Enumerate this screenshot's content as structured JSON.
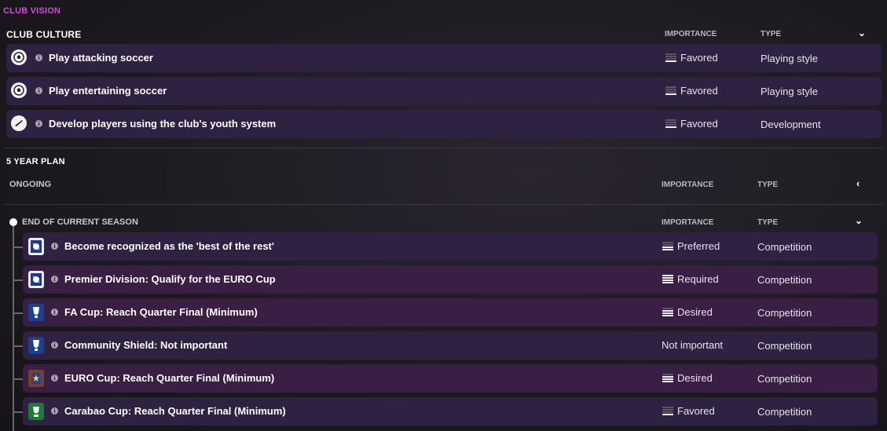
{
  "header": {
    "title": "CLUB VISION"
  },
  "club_culture": {
    "title": "CLUB CULTURE",
    "col_importance": "IMPORTANCE",
    "col_type": "TYPE",
    "items": [
      {
        "label": "Play attacking soccer",
        "importance": "Favored",
        "type": "Playing style",
        "icon": "soccer-ball-icon"
      },
      {
        "label": "Play entertaining soccer",
        "importance": "Favored",
        "type": "Playing style",
        "icon": "soccer-ball-icon"
      },
      {
        "label": "Develop players using the club's youth system",
        "importance": "Favored",
        "type": "Development",
        "icon": "boot-icon"
      }
    ]
  },
  "five_year_plan": {
    "title": "5 YEAR PLAN",
    "ongoing": {
      "title": "ONGOING",
      "col_importance": "IMPORTANCE",
      "col_type": "TYPE"
    },
    "current_season": {
      "title": "END OF CURRENT SEASON",
      "col_importance": "IMPORTANCE",
      "col_type": "TYPE",
      "items": [
        {
          "label": "Become recognized as the 'best of the rest'",
          "importance": "Preferred",
          "level": 2,
          "type": "Competition",
          "icon": "league-crest-icon"
        },
        {
          "label": "Premier Division: Qualify for the EURO Cup",
          "importance": "Required",
          "level": 4,
          "type": "Competition",
          "icon": "league-crest-icon"
        },
        {
          "label": "FA Cup: Reach Quarter Final (Minimum)",
          "importance": "Desired",
          "level": 3,
          "type": "Competition",
          "icon": "fa-cup-crest-icon"
        },
        {
          "label": "Community Shield: Not important",
          "importance": "Not important",
          "level": 0,
          "type": "Competition",
          "icon": "fa-cup-crest-icon"
        },
        {
          "label": "EURO Cup: Reach Quarter Final (Minimum)",
          "importance": "Desired",
          "level": 3,
          "type": "Competition",
          "icon": "euro-cup-crest-icon"
        },
        {
          "label": "Carabao Cup: Reach Quarter Final (Minimum)",
          "importance": "Favored",
          "level": 1,
          "type": "Competition",
          "icon": "carabao-cup-crest-icon"
        }
      ]
    }
  },
  "colors": {
    "accent": "#d24ad8",
    "row": "#2e2141",
    "row_highlight": "#3a1f44"
  }
}
